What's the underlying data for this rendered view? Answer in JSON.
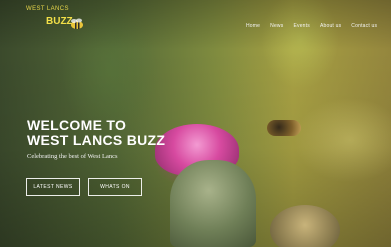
{
  "header": {
    "logo": {
      "west": "WEST LANCS",
      "buzz": "BUZZ"
    },
    "nav": {
      "items": [
        "Home",
        "News",
        "Events",
        "About us",
        "Contact us"
      ]
    }
  },
  "hero": {
    "title_line1": "WELCOME TO",
    "title_line2": "WEST LANCS BUZZ",
    "subtitle": "Celebrating the best of West Lancs",
    "buttons": {
      "news": "LATEST NEWS",
      "whatson": "WHATS ON"
    }
  },
  "colors": {
    "brand_yellow": "#f2df48",
    "text_white": "#ffffff"
  }
}
